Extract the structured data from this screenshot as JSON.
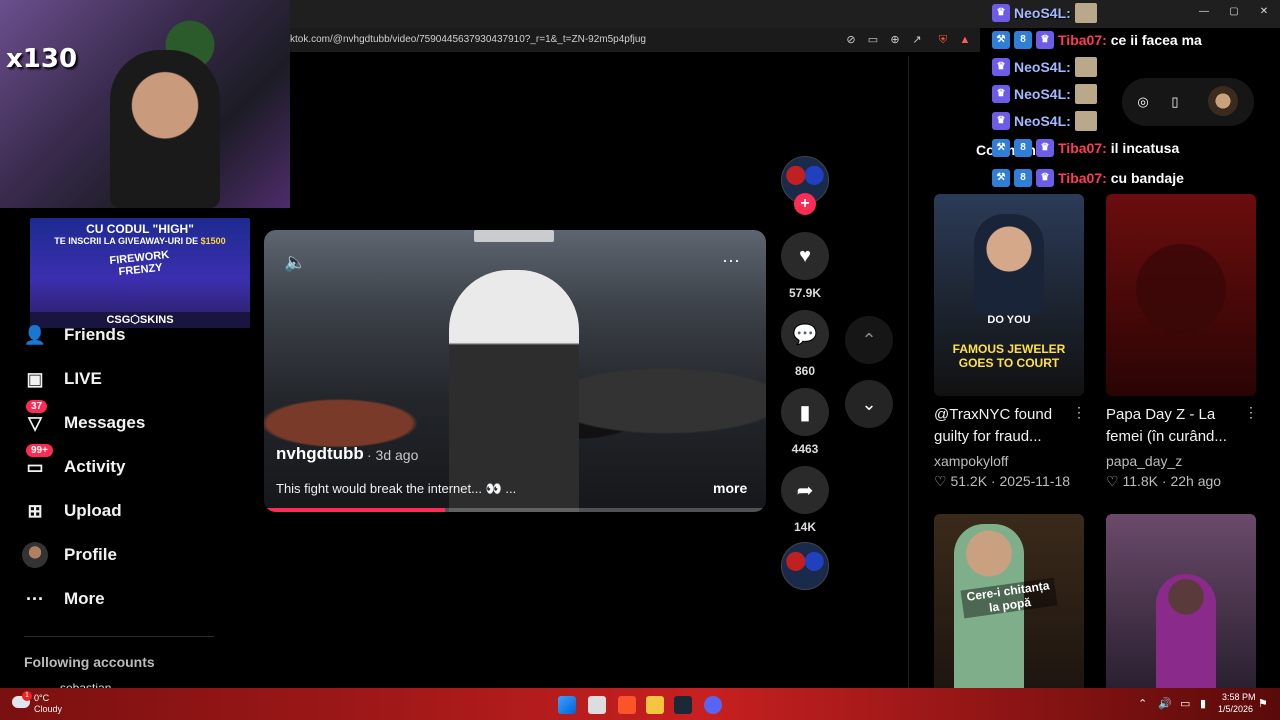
{
  "browser": {
    "url": "ktok.com/@nvhgdtubb/video/7590445637930437910?_r=1&_t=ZN-92m5p4pfjug",
    "window_controls": [
      "—",
      "▢",
      "✕"
    ]
  },
  "webcam": {
    "counter": "x130"
  },
  "banner": {
    "line1": "CU CODUL \"HIGH\"",
    "line2_prefix": "TE INSCRII LA GIVEAWAY-URI DE ",
    "line2_amount": "$1500",
    "game": "FIREWORK FRENZY",
    "brand": "CSG⬡SKINS"
  },
  "nav": {
    "items": [
      {
        "label": "Friends",
        "icon": "friends-icon",
        "glyph": "👥"
      },
      {
        "label": "LIVE",
        "icon": "live-icon",
        "glyph": "📺"
      },
      {
        "label": "Messages",
        "icon": "messages-icon",
        "glyph": "✉",
        "badge": "37"
      },
      {
        "label": "Activity",
        "icon": "activity-icon",
        "glyph": "💬",
        "badge": "99+"
      },
      {
        "label": "Upload",
        "icon": "upload-icon",
        "glyph": "⊞"
      },
      {
        "label": "Profile",
        "icon": "profile-avatar",
        "glyph": "●"
      },
      {
        "label": "More",
        "icon": "more-icon",
        "glyph": "···"
      }
    ],
    "following_title": "Following accounts",
    "following_first": "sebastian"
  },
  "video": {
    "author": "nvhgdtubb",
    "age": "· 3d ago",
    "caption": "This fight would break the internet... 👀 ...",
    "more_label": "more",
    "progress": 0.36
  },
  "actions": {
    "likes": "57.9K",
    "comments": "860",
    "saves": "4463",
    "shares": "14K"
  },
  "right": {
    "comments_label": "Comments",
    "thumbs": [
      {
        "title": "@TraxNYC found guilty for fraud...",
        "user": "xampokyloff",
        "likes": "51.2K",
        "date": "2025-11-18",
        "overlay1": "DO YOU",
        "overlay2": "FAMOUS JEWELER GOES TO COURT",
        "colors": [
          "#2b3b57",
          "#111"
        ]
      },
      {
        "title": "Papa Day Z - La femei (în curând...",
        "user": "papa_day_z",
        "likes": "11.8K",
        "date": "22h ago",
        "overlay1": "",
        "overlay2": "",
        "colors": [
          "#6b0d0d",
          "#2a0404"
        ]
      },
      {
        "overlay1": "Cere-i chitanța la popă",
        "colors": [
          "#3a2a1a",
          "#1e1510"
        ]
      },
      {
        "overlay1": "",
        "colors": [
          "#6a4a6a",
          "#2a2030"
        ]
      }
    ]
  },
  "chat": [
    {
      "user": "NeoS4L:",
      "type": "purple",
      "msg": ""
    },
    {
      "user": "Tiba07:",
      "type": "red",
      "msg": "ce ii facea ma"
    },
    {
      "user": "NeoS4L:",
      "type": "purple",
      "msg": ""
    },
    {
      "user": "NeoS4L:",
      "type": "purple",
      "msg": ""
    },
    {
      "user": "NeoS4L:",
      "type": "purple",
      "msg": ""
    },
    {
      "user": "Tiba07:",
      "type": "red",
      "msg": "il incatusa"
    },
    {
      "user": "Tiba07:",
      "type": "red",
      "msg": "cu bandaje"
    }
  ],
  "taskbar": {
    "temp": "0°C",
    "weather": "Cloudy",
    "time": "3:58 PM",
    "date": "1/5/2026",
    "weather_badge": "1"
  },
  "colors": {
    "accent": "#fe2c55",
    "taskbar": "#c82020"
  }
}
